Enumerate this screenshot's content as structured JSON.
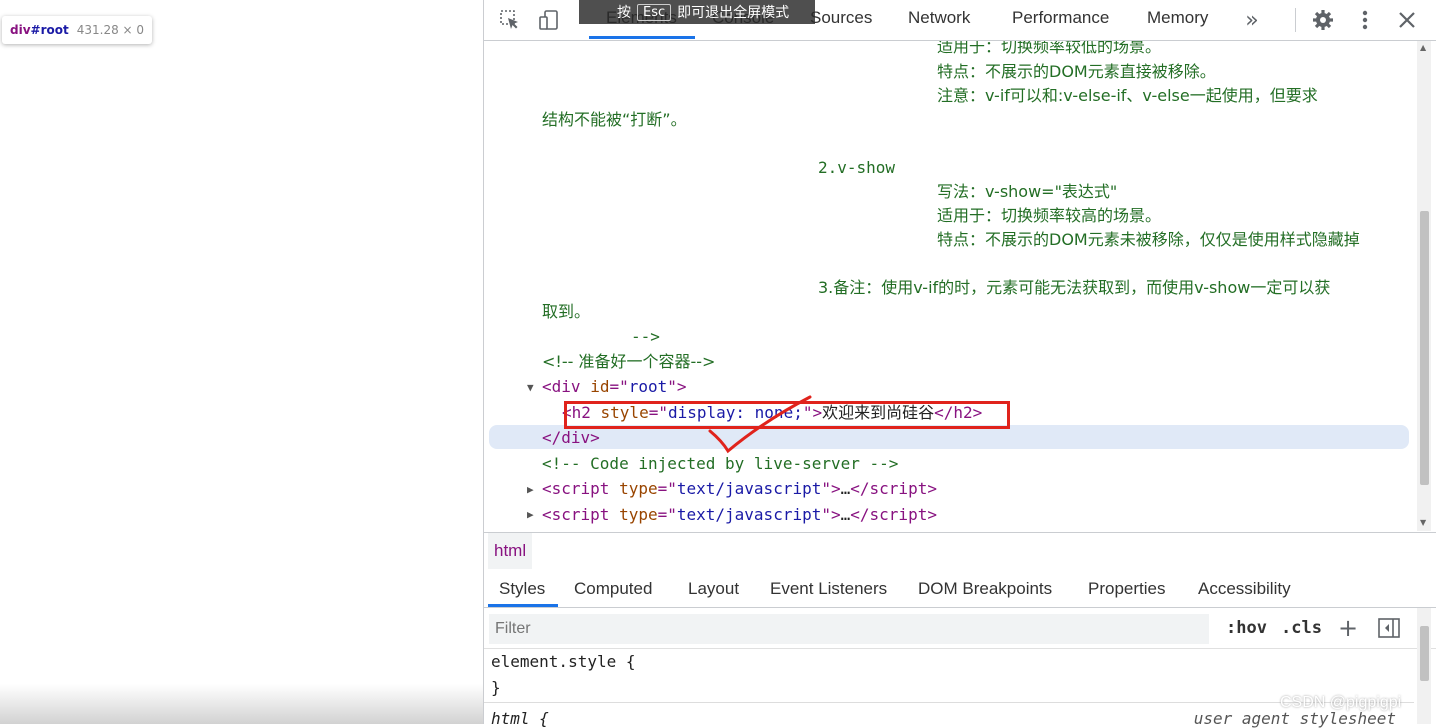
{
  "tooltip": {
    "tag": "div",
    "id": "#root",
    "size": "431.28 × 0"
  },
  "banner": {
    "prefix": "按",
    "key": "Esc",
    "suffix": "即可退出全屏模式"
  },
  "tabs": [
    "Elements",
    "Console",
    "Sources",
    "Network",
    "Performance",
    "Memory"
  ],
  "active_tab": "Elements",
  "elements": {
    "comment_lines": [
      "适用于：切换频率较低的场景。",
      "特点：不展示的DOM元素直接被移除。",
      "注意：v-if可以和:v-else-if、v-else一起使用，但要求",
      "结构不能被“打断”。",
      "2.v-show",
      "写法：v-show=\"表达式\"",
      "适用于：切换频率较高的场景。",
      "特点：不展示的DOM元素未被移除，仅仅是使用样式隐藏掉",
      "3.备注：使用v-if的时，元素可能无法获取到，而使用v-show一定可以获",
      "取到。",
      "-->"
    ],
    "comment_container": "<!-- 准备好一个容器-->",
    "div_open": {
      "tag": "div",
      "attr": "id",
      "value": "root"
    },
    "h2": {
      "attr": "style",
      "value": "display: none;",
      "text": "欢迎来到尚硅谷"
    },
    "div_close": "</div>",
    "comment_live": "<!-- Code injected by live-server -->",
    "script_rows": [
      {
        "attr": "type",
        "value": "text/javascript",
        "ellipsis": "…"
      },
      {
        "attr": "type",
        "value": "text/javascript",
        "ellipsis": "…"
      }
    ]
  },
  "breadcrumb": "html",
  "subtabs": [
    "Styles",
    "Computed",
    "Layout",
    "Event Listeners",
    "DOM Breakpoints",
    "Properties",
    "Accessibility"
  ],
  "active_subtab": "Styles",
  "filter": {
    "placeholder": "Filter",
    "hov": ":hov",
    "cls": ".cls"
  },
  "styles": {
    "element_style_open": "element.style {",
    "element_style_close": "}",
    "next_rule": "html {",
    "next_origin": "user agent stylesheet"
  },
  "watermark": "CSDN @pigpigpi",
  "icons": [
    "inspect-icon",
    "device-toggle-icon",
    "more-tabs-icon",
    "settings-icon",
    "kebab-menu-icon",
    "close-icon",
    "new-rule-icon",
    "toggle-sidebar-icon"
  ]
}
